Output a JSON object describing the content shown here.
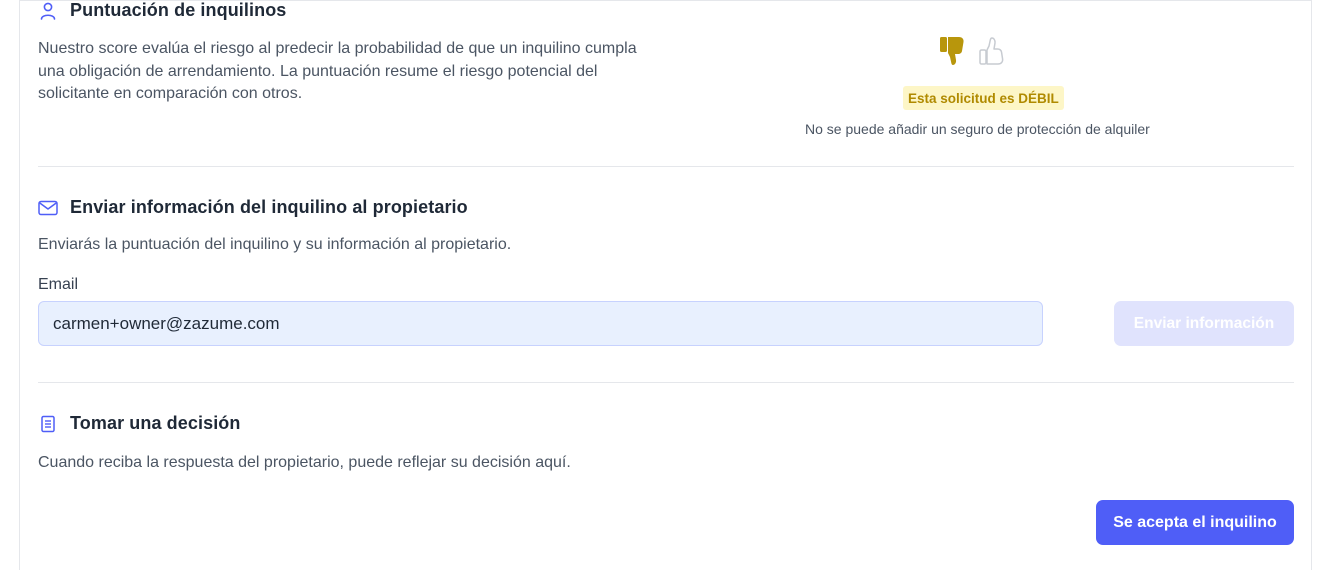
{
  "score_section": {
    "title": "Puntuación de inquilinos",
    "icon": "user-icon",
    "description_lines": [
      "Nuestro score evalúa el riesgo al predecir la probabilidad de que un inquilino cumpla",
      "una obligación de arrendamiento. La puntuación resume el riesgo potencial del",
      "solicitante en comparación con otros."
    ],
    "rating_badge": "Esta solicitud es DÉBIL",
    "insurance_note": "No se puede añadir un seguro de protección de alquiler",
    "thumb_down_color": "#b8960c",
    "thumb_up_color": "#c7cbd1",
    "badge_bg": "#fdf6c7"
  },
  "send_section": {
    "title": "Enviar información del inquilino al propietario",
    "icon": "mail-icon",
    "description": "Enviarás la puntuación del inquilino y su información al propietario.",
    "email_label": "Email",
    "email_value": "carmen+owner@zazume.com",
    "send_button": "Enviar información"
  },
  "decision_section": {
    "title": "Tomar una decisión",
    "icon": "document-icon",
    "description": "Cuando reciba la respuesta del propietario, puede reflejar su decisión aquí.",
    "accept_button": "Se acepta el inquilino"
  },
  "colors": {
    "accent": "#4f5ef7",
    "accent_disabled": "#e0e3fd",
    "input_bg": "#e8f0fe"
  }
}
